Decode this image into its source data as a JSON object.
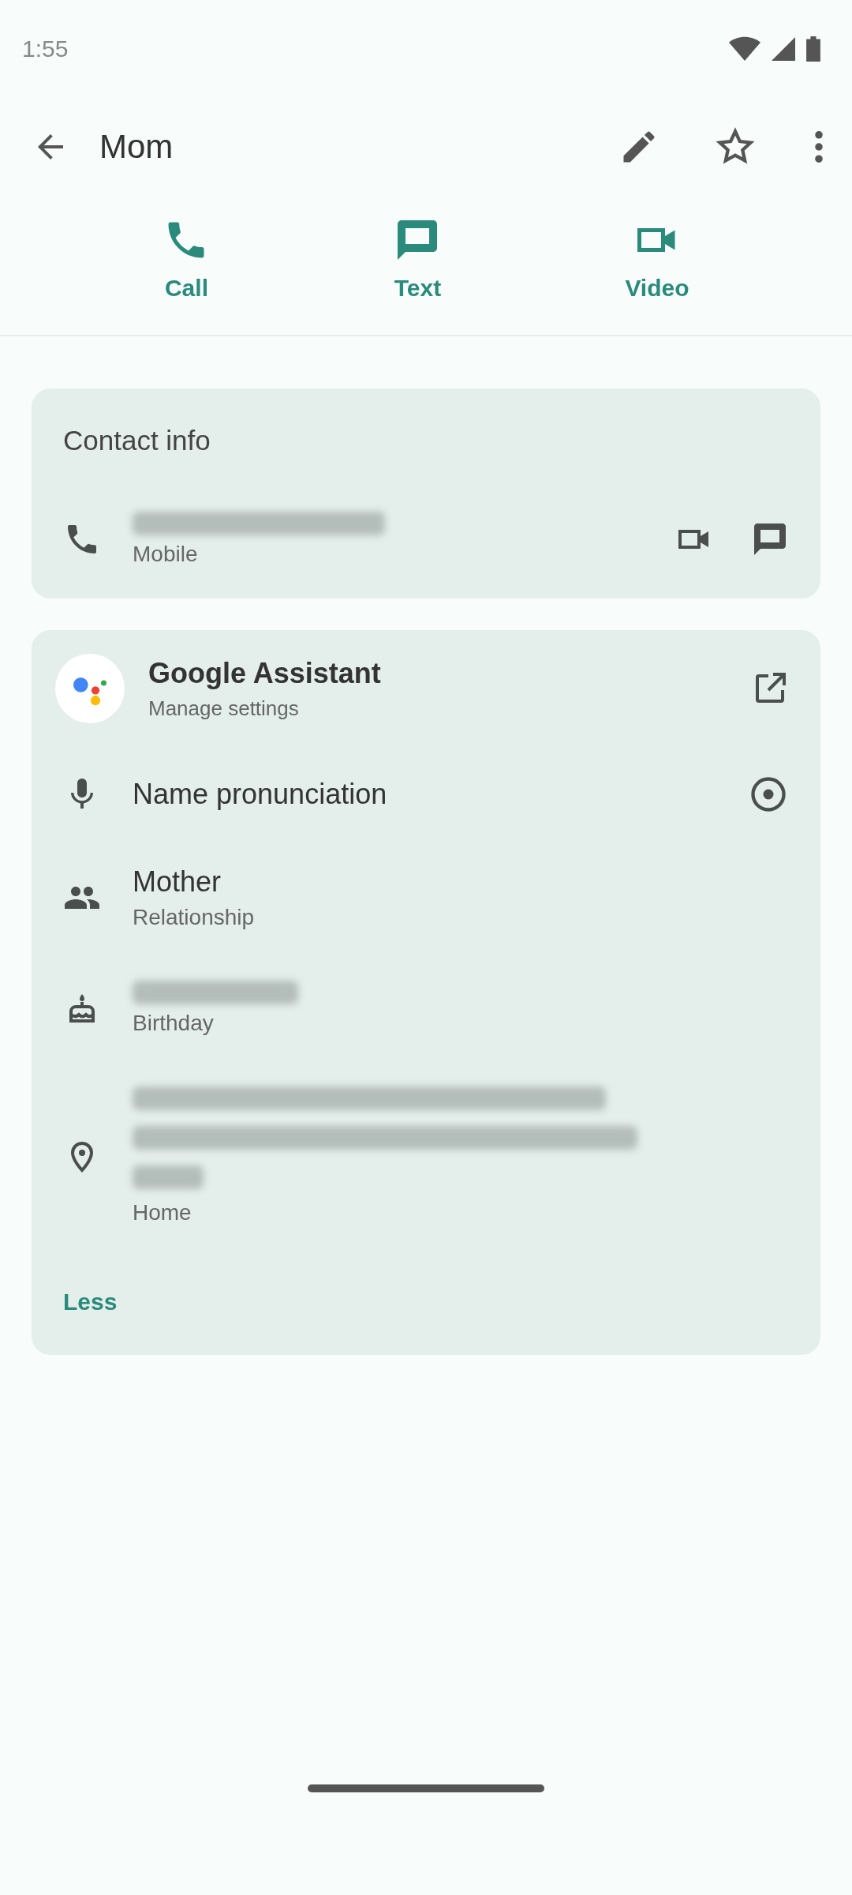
{
  "status_bar": {
    "time": "1:55"
  },
  "app_bar": {
    "title": "Mom"
  },
  "quick_actions": [
    {
      "kind": "call",
      "label": "Call"
    },
    {
      "kind": "text",
      "label": "Text"
    },
    {
      "kind": "video",
      "label": "Video"
    }
  ],
  "contact_info": {
    "title": "Contact info",
    "phone": {
      "label": "Mobile"
    }
  },
  "details": {
    "items": [
      {
        "kind": "assistant",
        "title": "Google Assistant",
        "subtitle": "Manage settings"
      },
      {
        "kind": "pronunciation",
        "title": "Name pronunciation"
      },
      {
        "kind": "relationship",
        "title": "Mother",
        "subtitle": "Relationship"
      },
      {
        "kind": "birthday",
        "subtitle": "Birthday"
      },
      {
        "kind": "address",
        "subtitle": "Home"
      }
    ],
    "toggle": "Less"
  }
}
